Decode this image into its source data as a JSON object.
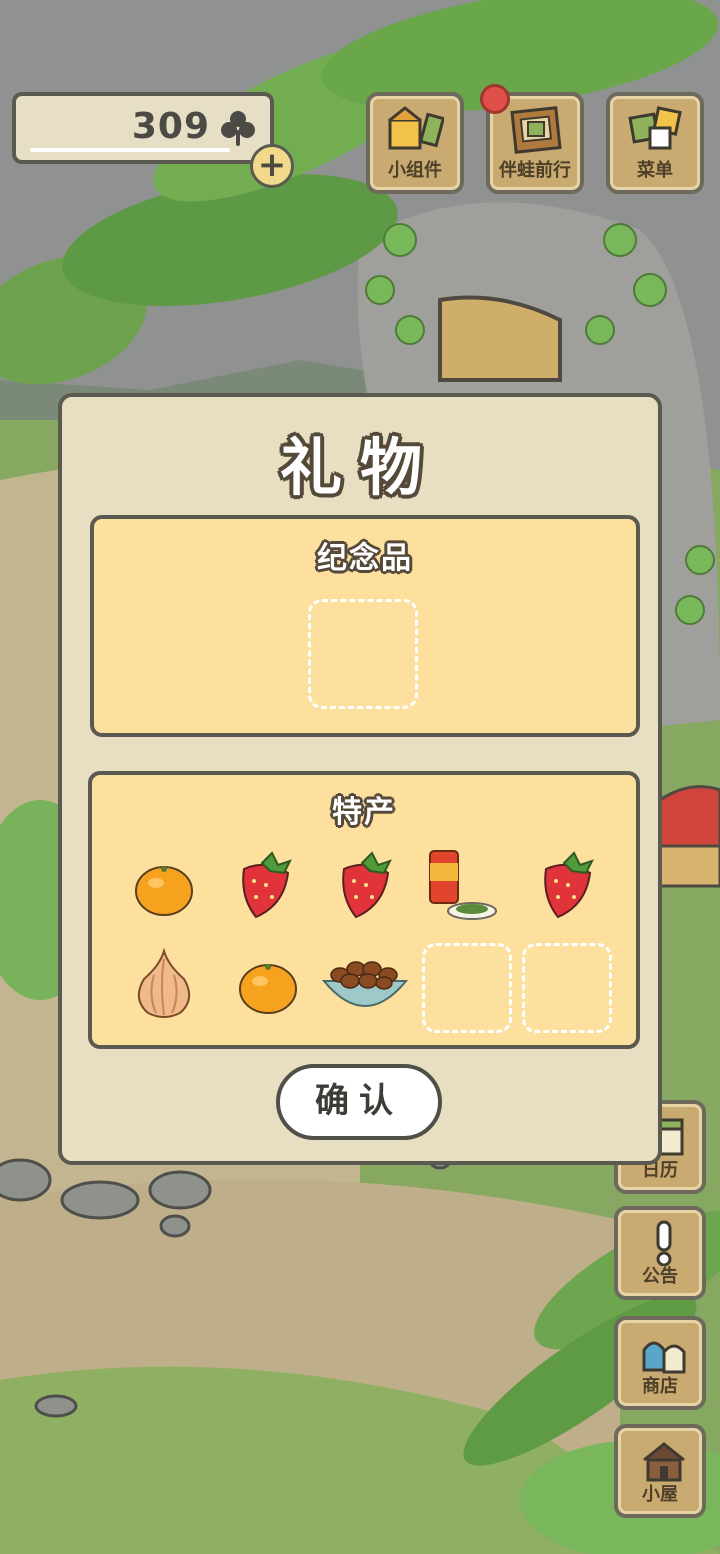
{
  "hud": {
    "clover_count": "309",
    "clover_icon": "clover-icon",
    "plus_icon": "+"
  },
  "top_buttons": [
    {
      "label": "小组件",
      "icon": "widget-icon"
    },
    {
      "label": "伴蛙前行",
      "icon": "album-icon",
      "has_notification": true
    },
    {
      "label": "菜单",
      "icon": "menu-icon"
    }
  ],
  "side_buttons": [
    {
      "label": "日历",
      "icon": "calendar-icon"
    },
    {
      "label": "公告",
      "icon": "exclamation-icon"
    },
    {
      "label": "商店",
      "icon": "shop-bags-icon"
    },
    {
      "label": "小屋",
      "icon": "house-icon"
    }
  ],
  "dialog": {
    "title": "礼物",
    "souvenir": {
      "title": "纪念品",
      "items": []
    },
    "specialty": {
      "title": "特产",
      "items": [
        "orange",
        "strawberry",
        "strawberry",
        "tea-can",
        "strawberry",
        "onion",
        "orange",
        "chestnuts-bowl",
        "",
        ""
      ]
    },
    "confirm_label": "确认"
  },
  "colors": {
    "panel_fill": "#fde09e",
    "dialog_fill": "#e8dec2",
    "notification": "#e0504a"
  }
}
